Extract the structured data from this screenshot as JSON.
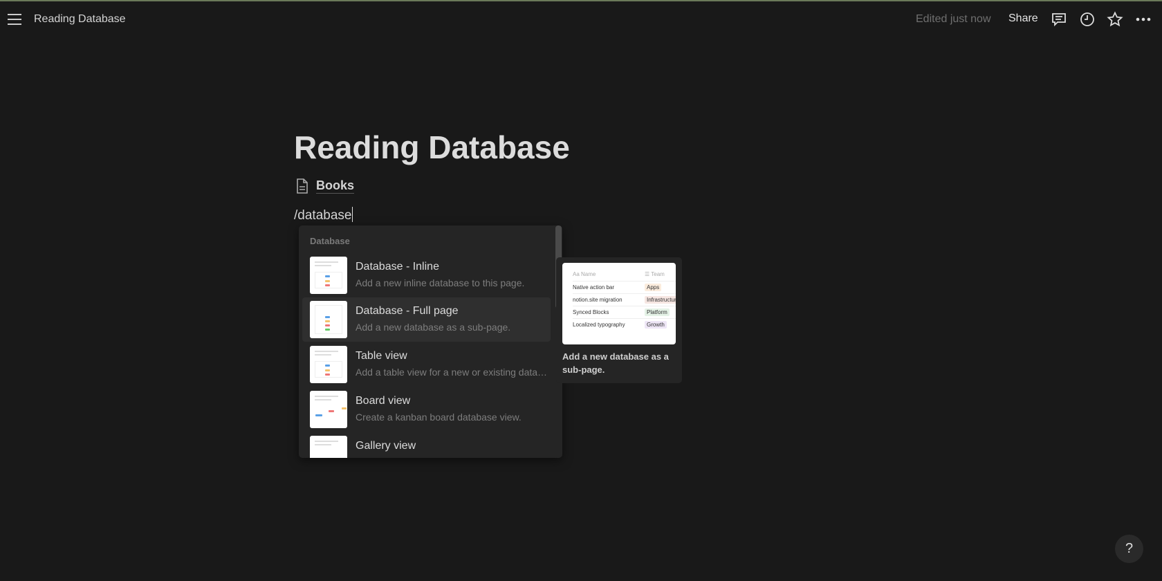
{
  "header": {
    "title": "Reading Database",
    "edited": "Edited just now",
    "share": "Share"
  },
  "page": {
    "title": "Reading Database",
    "subpage": "Books",
    "command": "/database"
  },
  "menu": {
    "section": "Database",
    "items": [
      {
        "title": "Database - Inline",
        "desc": "Add a new inline database to this page."
      },
      {
        "title": "Database - Full page",
        "desc": "Add a new database as a sub-page."
      },
      {
        "title": "Table view",
        "desc": "Add a table view for a new or existing database"
      },
      {
        "title": "Board view",
        "desc": "Create a kanban board database view."
      },
      {
        "title": "Gallery view",
        "desc": ""
      }
    ]
  },
  "preview": {
    "col_name": "Aa Name",
    "col_team": "☰ Team",
    "rows": [
      {
        "name": "Native action bar",
        "team": "Apps",
        "color": "#fbecdd"
      },
      {
        "name": "notion.site migration",
        "team": "Infrastructure",
        "color": "#f6e6e2"
      },
      {
        "name": "Synced Blocks",
        "team": "Platform",
        "color": "#e4f2e6"
      },
      {
        "name": "Localized typography",
        "team": "Growth",
        "color": "#eee6f6"
      }
    ],
    "caption": "Add a new database as a sub-page."
  },
  "help": "?"
}
